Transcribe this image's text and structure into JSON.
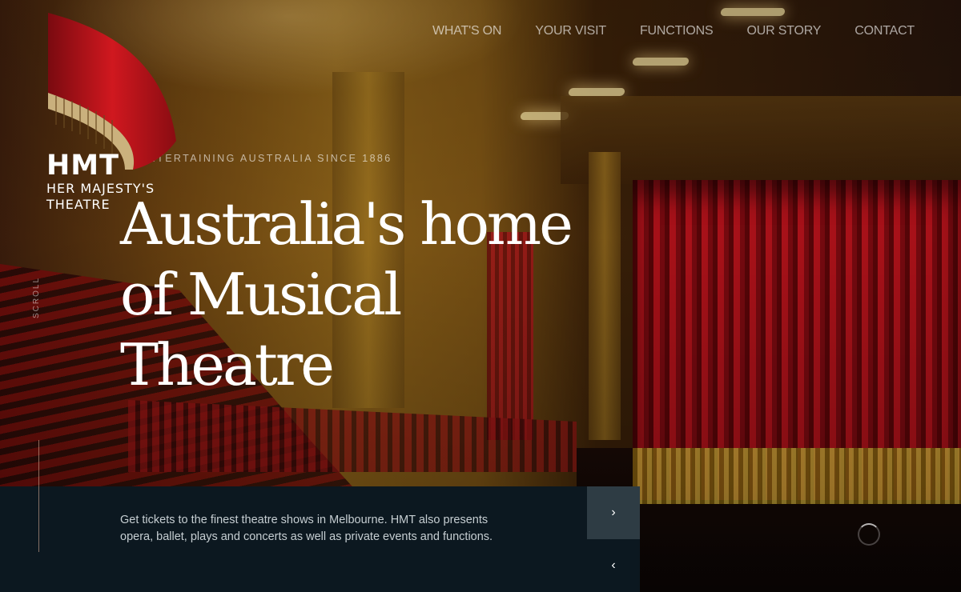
{
  "brand": {
    "abbr": "HMT",
    "name_line1": "HER MAJESTY'S",
    "name_line2": "THEATRE",
    "accent_red": "#c8161e"
  },
  "nav": {
    "items": [
      {
        "label": "WHAT'S ON"
      },
      {
        "label": "YOUR VISIT"
      },
      {
        "label": "FUNCTIONS"
      },
      {
        "label": "OUR STORY"
      },
      {
        "label": "CONTACT"
      }
    ]
  },
  "hero": {
    "tagline": "ENTERTAINING AUSTRALIA SINCE 1886",
    "headline_line1": "Australia's home",
    "headline_line2": "of Musical",
    "headline_line3": "Theatre",
    "scroll_label": "SCROLL",
    "description": "Get tickets to the finest theatre shows in Melbourne. HMT also presents opera, ballet, plays and concerts as well as private events and functions."
  },
  "slider": {
    "next_icon": "chevron-right-icon",
    "prev_icon": "chevron-left-icon",
    "next_glyph": "›",
    "prev_glyph": "‹"
  },
  "colors": {
    "panel_bg": "#0c1820",
    "next_btn_bg": "#2e3c44"
  }
}
